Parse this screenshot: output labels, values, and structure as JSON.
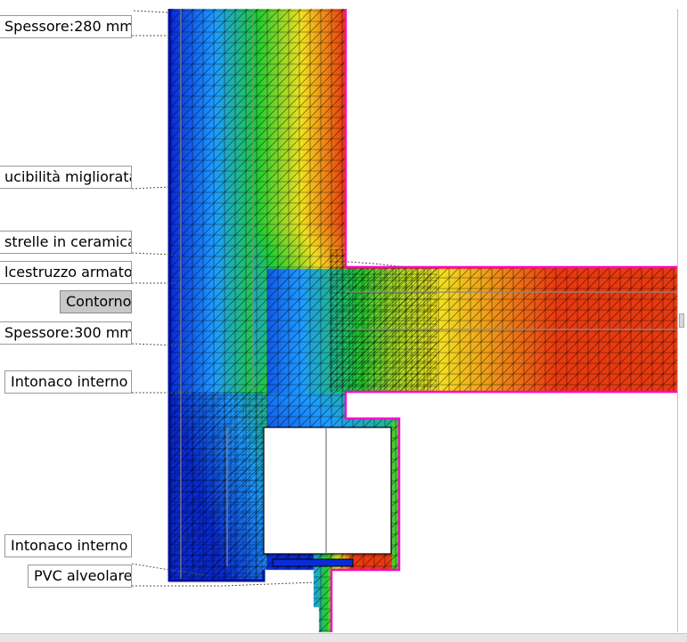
{
  "labels": {
    "spessore_280": "Spessore:280 mm",
    "conducibilita": "ucibilità migliorata",
    "piastrelle": "strelle in ceramica",
    "calcestruzzo": "lcestruzzo armato",
    "contorno": "Contorno",
    "spessore_300": "Spessore:300 mm",
    "intonaco_interno_1": "Intonaco interno",
    "intonaco_interno_2": "Intonaco interno",
    "pvc": "PVC alveolare"
  },
  "colors": {
    "cold": "#0a2bd8",
    "cool": "#1e9bff",
    "mid": "#22cc33",
    "warm": "#f2e020",
    "hot": "#e83a10",
    "boundary": "#ff00cc",
    "mesh_line": "#000000",
    "window_fill": "#ffffff"
  },
  "icons": {
    "scroll": "scroll-handle"
  }
}
